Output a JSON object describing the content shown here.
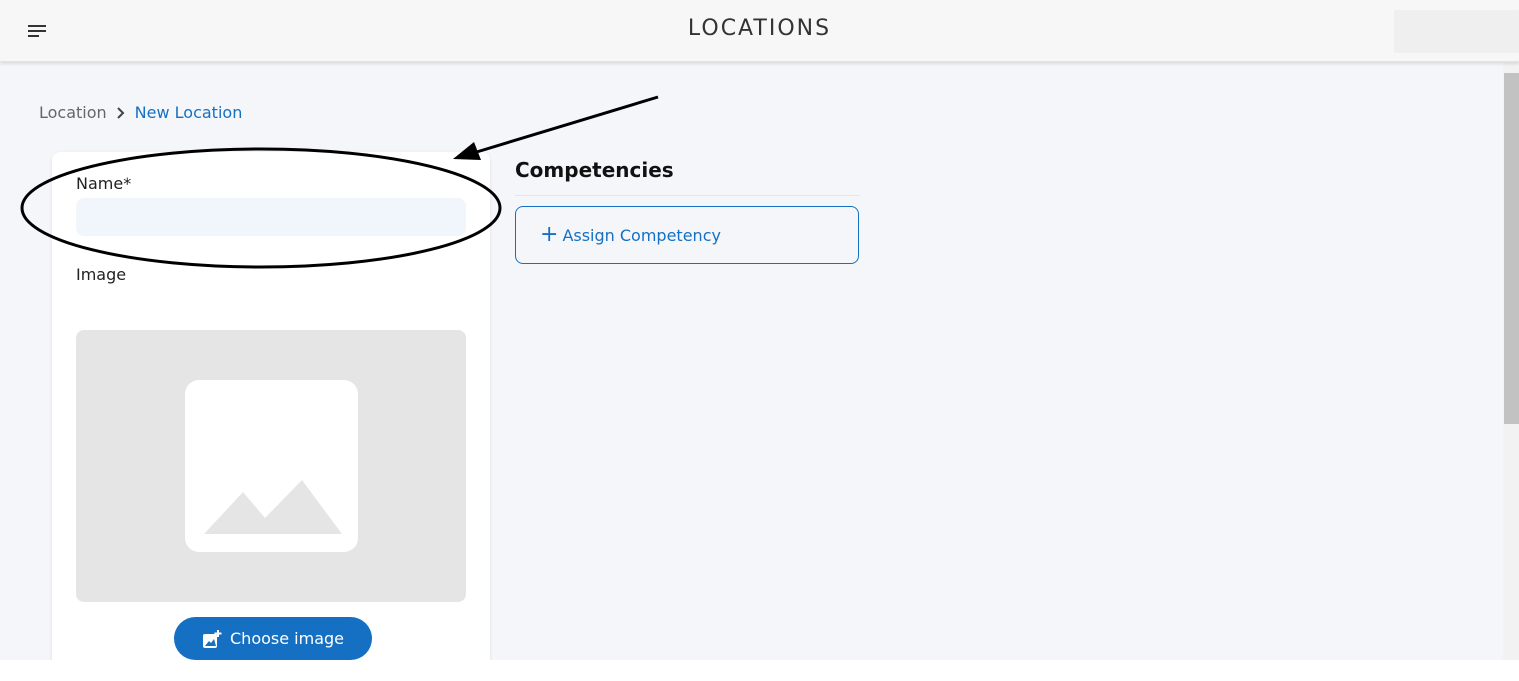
{
  "header": {
    "title": "LOCATIONS",
    "menu_icon": "hamburger-menu-icon"
  },
  "breadcrumb": {
    "root": "Location",
    "separator_icon": "chevron-right-icon",
    "current": "New Location"
  },
  "form": {
    "name_label": "Name*",
    "name_value": "",
    "name_placeholder": "",
    "image_label": "Image",
    "image_placeholder_icon": "image-placeholder-icon",
    "choose_image_label": "Choose image",
    "choose_image_icon": "add-photo-icon"
  },
  "competencies": {
    "title": "Competencies",
    "assign_label": "Assign Competency",
    "assign_icon": "plus-icon"
  },
  "annotation": {
    "shape": "ellipse-with-arrow",
    "target": "name-field"
  },
  "colors": {
    "accent": "#1570c4",
    "page_background": "#f4f6fa",
    "input_background": "#f1f6fc",
    "image_box": "#e5e5e5"
  }
}
